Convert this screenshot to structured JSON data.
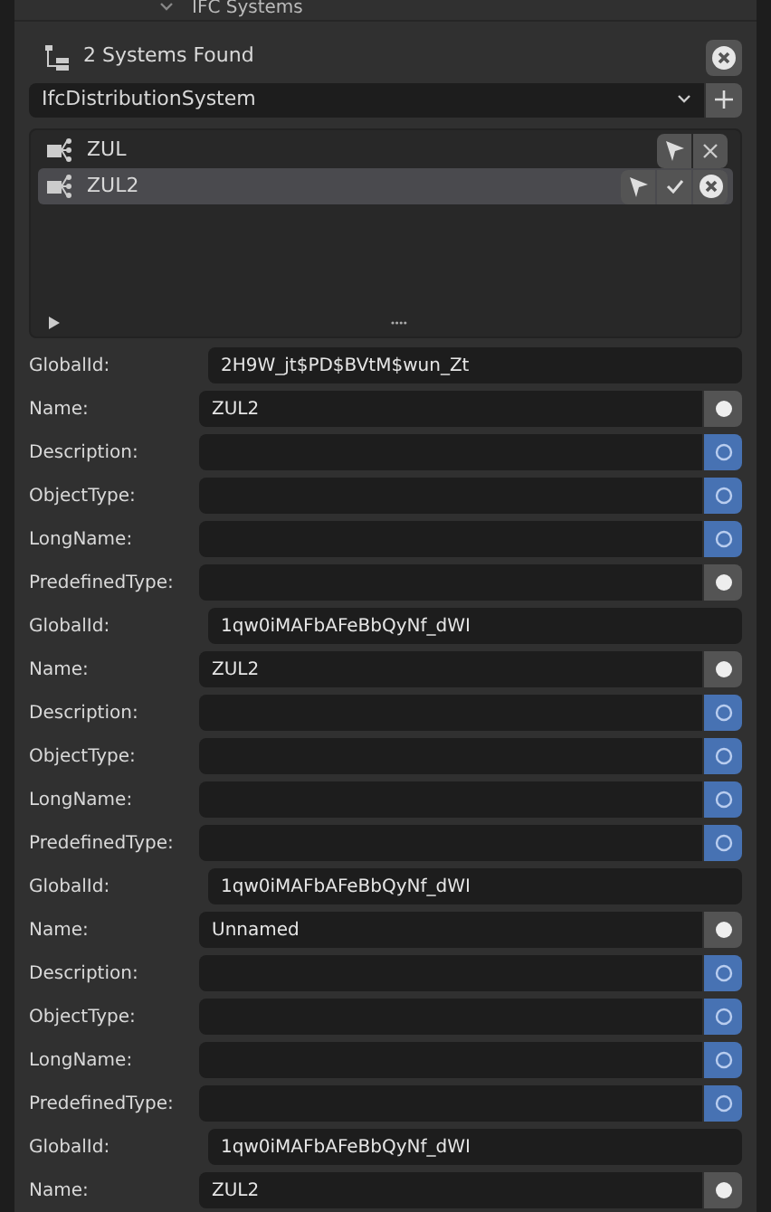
{
  "panel": {
    "title": "IFC Systems",
    "expanded": true
  },
  "header": {
    "label": "2 Systems Found"
  },
  "class_dropdown": {
    "value": "IfcDistributionSystem"
  },
  "systems": [
    {
      "name": "ZUL",
      "selected": false
    },
    {
      "name": "ZUL2",
      "selected": true
    }
  ],
  "attribute_groups": [
    {
      "attributes": [
        {
          "kind": "id",
          "label": "GlobalId:",
          "value": "2H9W_jt$PD$BVtM$wun_Zt"
        },
        {
          "kind": "attribute",
          "label": "Name:",
          "value": "ZUL2",
          "is_null": false
        },
        {
          "kind": "attribute",
          "label": "Description:",
          "is_null": true
        },
        {
          "kind": "attribute",
          "label": "ObjectType:",
          "is_null": true
        },
        {
          "kind": "attribute",
          "label": "LongName:",
          "is_null": true
        },
        {
          "kind": "attribute",
          "label": "PredefinedType:",
          "is_null": false
        }
      ]
    },
    {
      "attributes": [
        {
          "kind": "id",
          "label": "GlobalId:",
          "value": "1qw0iMAFbAFeBbQyNf_dWI"
        },
        {
          "kind": "attribute",
          "label": "Name:",
          "value": "ZUL2",
          "is_null": false
        },
        {
          "kind": "attribute",
          "label": "Description:",
          "is_null": true
        },
        {
          "kind": "attribute",
          "label": "ObjectType:",
          "is_null": true
        },
        {
          "kind": "attribute",
          "label": "LongName:",
          "is_null": true
        },
        {
          "kind": "attribute",
          "label": "PredefinedType:",
          "is_null": true
        }
      ]
    },
    {
      "attributes": [
        {
          "kind": "id",
          "label": "GlobalId:",
          "value": "1qw0iMAFbAFeBbQyNf_dWI"
        },
        {
          "kind": "attribute",
          "label": "Name:",
          "value": "Unnamed",
          "is_null": false
        },
        {
          "kind": "attribute",
          "label": "Description:",
          "is_null": true
        },
        {
          "kind": "attribute",
          "label": "ObjectType:",
          "is_null": true
        },
        {
          "kind": "attribute",
          "label": "LongName:",
          "is_null": true
        },
        {
          "kind": "attribute",
          "label": "PredefinedType:",
          "is_null": true
        }
      ]
    },
    {
      "attributes": [
        {
          "kind": "id",
          "label": "GlobalId:",
          "value": "1qw0iMAFbAFeBbQyNf_dWI"
        },
        {
          "kind": "attribute",
          "label": "Name:",
          "value": "ZUL2",
          "is_null": false
        }
      ]
    }
  ]
}
